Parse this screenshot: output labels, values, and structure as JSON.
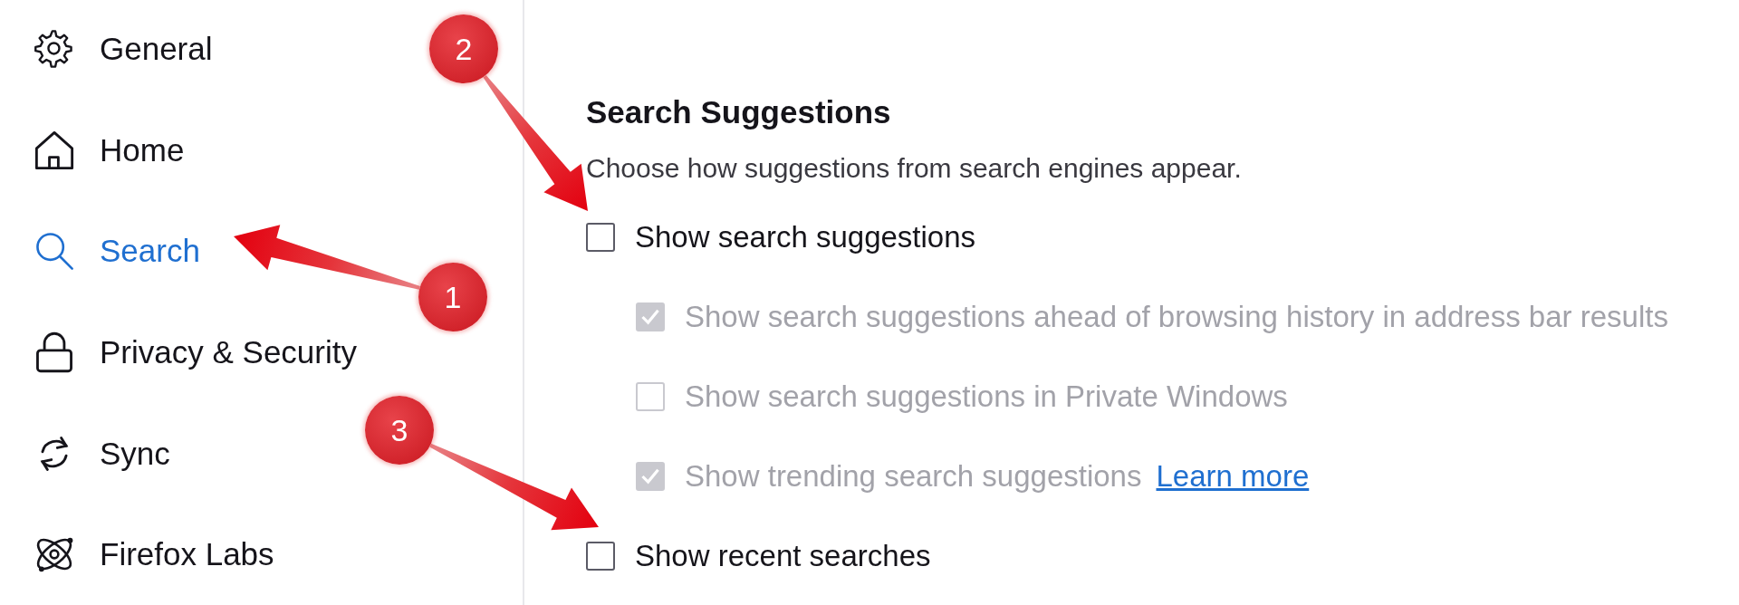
{
  "sidebar": {
    "items": [
      {
        "label": "General",
        "selected": false
      },
      {
        "label": "Home",
        "selected": false
      },
      {
        "label": "Search",
        "selected": true
      },
      {
        "label": "Privacy & Security",
        "selected": false
      },
      {
        "label": "Sync",
        "selected": false
      },
      {
        "label": "Firefox Labs",
        "selected": false
      }
    ]
  },
  "section": {
    "title": "Search Suggestions",
    "description": "Choose how suggestions from search engines appear.",
    "options": [
      {
        "label": "Show search suggestions",
        "checked": false,
        "disabled": false,
        "children": [
          {
            "label": "Show search suggestions ahead of browsing history in address bar results",
            "checked": true,
            "disabled": true
          },
          {
            "label": "Show search suggestions in Private Windows",
            "checked": false,
            "disabled": true
          },
          {
            "label": "Show trending search suggestions",
            "checked": true,
            "disabled": true,
            "link": "Learn more"
          }
        ]
      },
      {
        "label": "Show recent searches",
        "checked": false,
        "disabled": false
      }
    ]
  },
  "callouts": [
    {
      "number": "1"
    },
    {
      "number": "2"
    },
    {
      "number": "3"
    }
  ]
}
